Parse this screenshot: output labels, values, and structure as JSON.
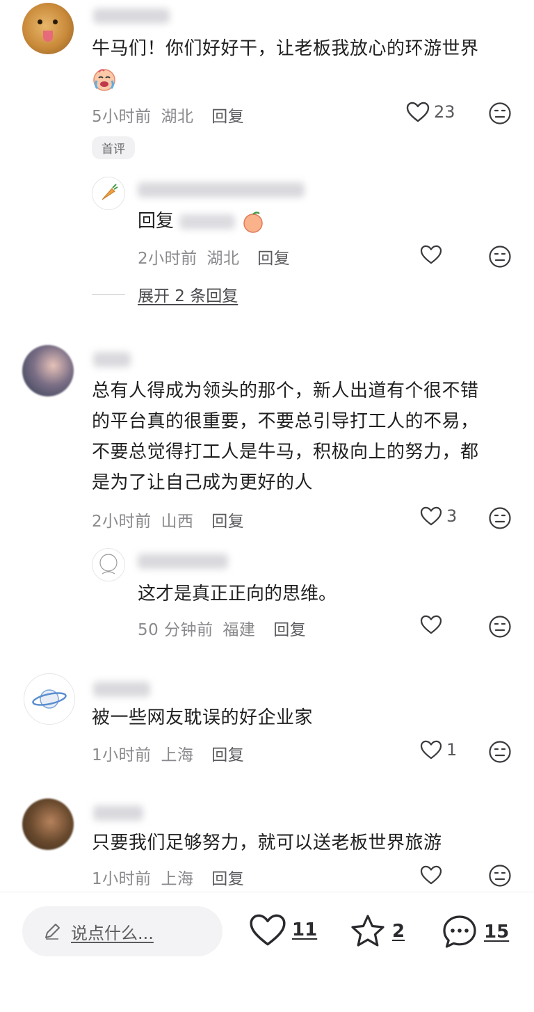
{
  "comments": [
    {
      "text_line1": "牛马们！你们好好干，让老板我放心的环游世界",
      "sticker": "crying-laughing-emoji",
      "time": "5小时前",
      "location": "湖北",
      "reply_label": "回复",
      "likes": "23",
      "badge": "首评",
      "replies": [
        {
          "prefix": "回复",
          "time": "2小时前",
          "location": "湖北",
          "reply_label": "回复"
        }
      ],
      "expand_label": "展开 2 条回复"
    },
    {
      "text_lines": [
        "总有人得成为领头的那个，新人出道有个很不错",
        "的平台真的很重要，不要总引导打工人的不易，",
        "不要总觉得打工人是牛马，积极向上的努力，都",
        "是为了让自己成为更好的人"
      ],
      "time": "2小时前",
      "location": "山西",
      "reply_label": "回复",
      "likes": "3",
      "replies": [
        {
          "text": "这才是真正正向的思维。",
          "time": "50 分钟前",
          "location": "福建",
          "reply_label": "回复"
        }
      ]
    },
    {
      "text": "被一些网友耽误的好企业家",
      "time": "1小时前",
      "location": "上海",
      "reply_label": "回复",
      "likes": "1"
    },
    {
      "text": "只要我们足够努力，就可以送老板世界旅游",
      "time": "1小时前",
      "location": "上海",
      "reply_label": "回复"
    }
  ],
  "bottom": {
    "input_placeholder": "说点什么...",
    "like_count": "11",
    "star_count": "2",
    "comment_count": "15"
  },
  "icons": {
    "like": "heart-outline-icon",
    "dislike": "neutral-face-icon",
    "star": "star-outline-icon",
    "comment": "chat-bubble-icon",
    "edit": "pencil-icon"
  }
}
